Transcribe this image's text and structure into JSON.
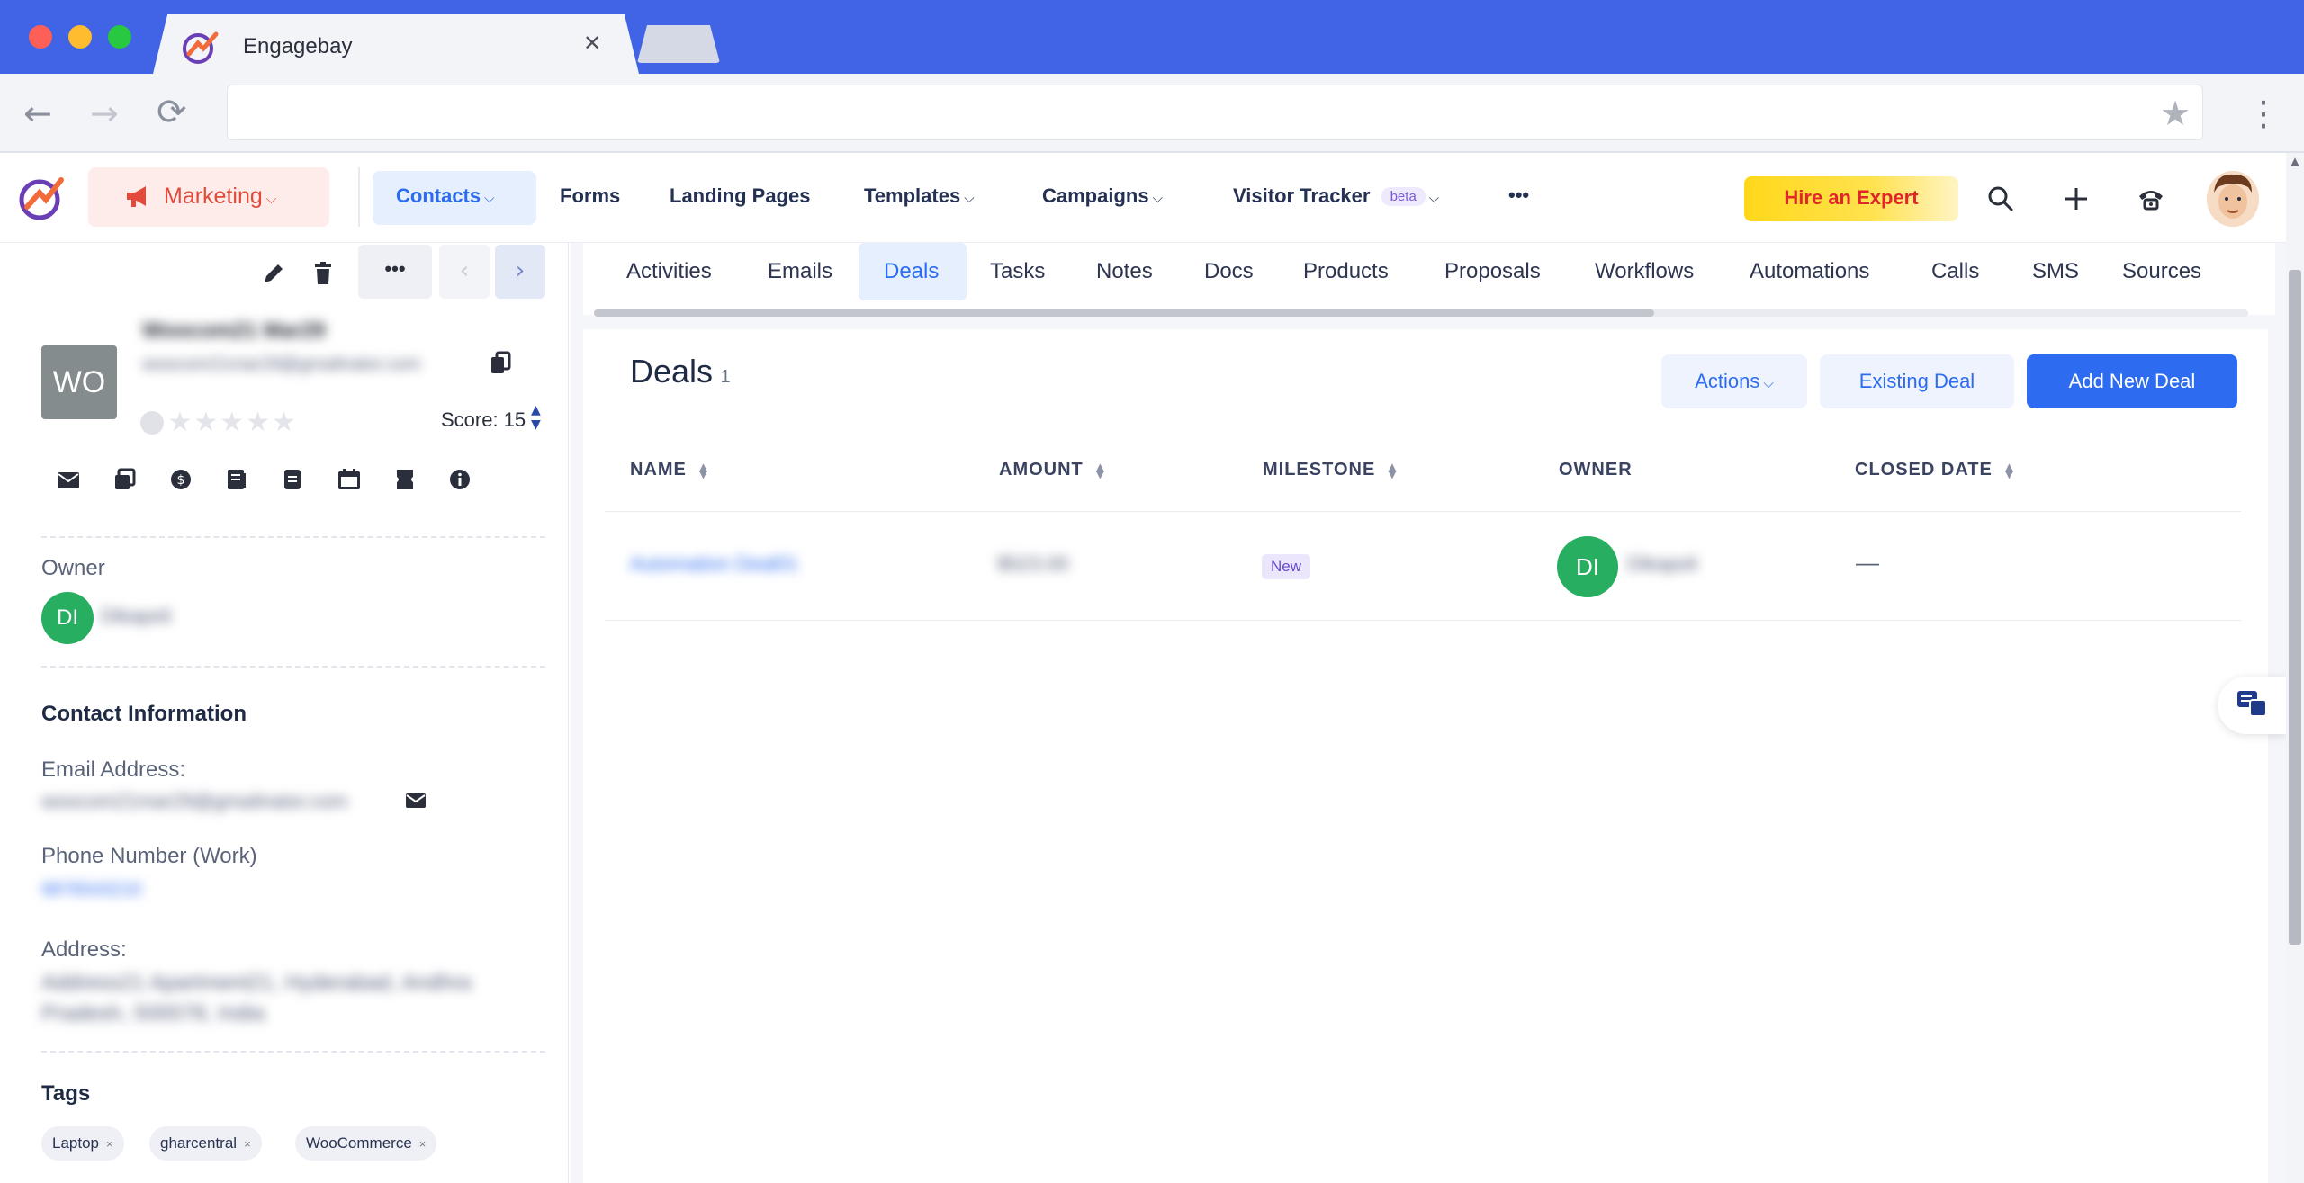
{
  "browser": {
    "tab_title": "Engagebay",
    "tab_close": "✕",
    "back": "←",
    "forward": "→",
    "reload": "⟳",
    "star": "★",
    "menu": "⋮"
  },
  "header": {
    "marketing": "Marketing",
    "nav": [
      "Contacts",
      "Forms",
      "Landing Pages",
      "Templates",
      "Campaigns",
      "Visitor Tracker"
    ],
    "beta": "beta",
    "more": "•••",
    "hire_expert": "Hire an Expert"
  },
  "contact": {
    "initials": "WO",
    "name": "Woocom21 Mar29",
    "email": "woocom21mar29@gmailnator.com",
    "score_label": "Score: 15",
    "owner_label": "Owner",
    "owner_initials": "DI",
    "owner_name": "Dikapoli",
    "contact_info_title": "Contact Information",
    "email_label": "Email Address:",
    "email_value": "woocom21mar29@gmailnator.com",
    "phone_label": "Phone Number (Work)",
    "phone_value": "9876543210",
    "address_label": "Address:",
    "address_value": "Address21 Apartment21, Hyderabad, Andhra Pradesh, 500078, India",
    "tags_title": "Tags",
    "tags": [
      "Laptop",
      "gharcentral",
      "WooCommerce"
    ],
    "tag_remove": "×"
  },
  "tabs": [
    "Activities",
    "Emails",
    "Deals",
    "Tasks",
    "Notes",
    "Docs",
    "Products",
    "Proposals",
    "Workflows",
    "Automations",
    "Calls",
    "SMS",
    "Sources"
  ],
  "active_tab": "Deals",
  "deals": {
    "title": "Deals",
    "count": "1",
    "actions_label": "Actions",
    "existing_deal_label": "Existing Deal",
    "add_new_label": "Add New Deal",
    "columns": [
      "NAME",
      "AMOUNT",
      "MILESTONE",
      "OWNER",
      "CLOSED DATE"
    ],
    "rows": [
      {
        "name": "Automation Deal01",
        "amount": "$523.00",
        "milestone": "New",
        "owner_initials": "DI",
        "owner_name": "Dikapoli",
        "closed_date": "—"
      }
    ]
  },
  "colors": {
    "chrome_blue": "#4164e6",
    "primary": "#2d6cf0",
    "owner_green": "#27ae60",
    "marketing_red": "#e24b3b",
    "hire_yellow": "#ffd81a"
  }
}
